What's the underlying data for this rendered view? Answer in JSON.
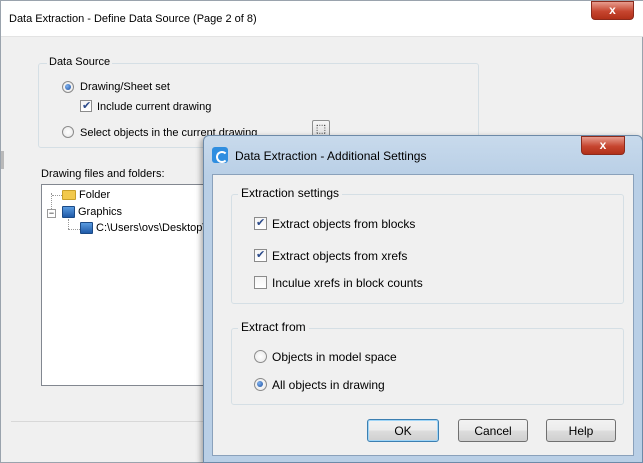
{
  "back_window": {
    "title": "Data Extraction - Define Data Source (Page 2 of 8)",
    "close_glyph": "x",
    "data_source": {
      "group_label": "Data Source",
      "drawing_sheet_set": "Drawing/Sheet set",
      "include_current_drawing": "Include current drawing",
      "select_objects": "Select objects in the current drawing"
    },
    "files_label": "Drawing files and folders:",
    "tree": {
      "folder": "Folder",
      "graphics": "Graphics",
      "path": "C:\\Users\\ovs\\Desktop\\"
    }
  },
  "dialog": {
    "title": "Data Extraction - Additional Settings",
    "close_glyph": "x",
    "extraction_settings": {
      "label": "Extraction settings",
      "extract_blocks": "Extract objects from blocks",
      "extract_xrefs": "Extract objects from xrefs",
      "include_xrefs_counts": "Inculue xrefs in block counts"
    },
    "extract_from": {
      "label": "Extract from",
      "model_space": "Objects in model space",
      "all_objects": "All objects in drawing"
    },
    "buttons": {
      "ok": "OK",
      "cancel": "Cancel",
      "help": "Help"
    }
  }
}
